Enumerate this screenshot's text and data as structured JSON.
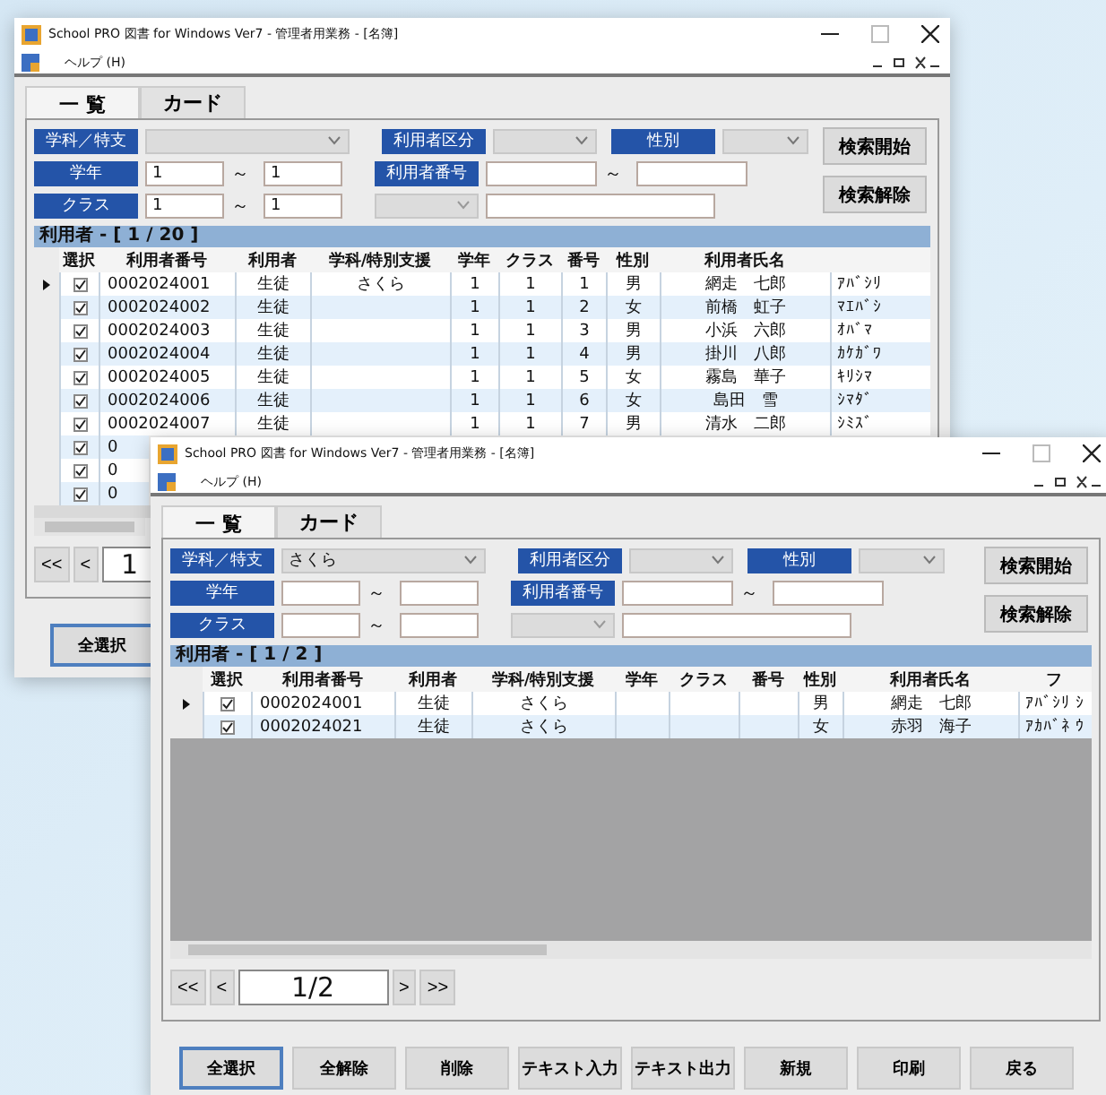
{
  "windows": [
    {
      "title": "School PRO 図書 for Windows Ver7 - 管理者用業務 - [名簿]",
      "menu": [
        "ヘルプ (H)"
      ],
      "tabs": [
        {
          "label": "一 覧",
          "selected": true
        },
        {
          "label": "カード",
          "selected": false
        }
      ],
      "filters": {
        "dept": {
          "label": "学科／特支"
        },
        "user_type": {
          "label": "利用者区分"
        },
        "gender": {
          "label": "性別"
        },
        "grade": {
          "label": "学年",
          "from": "1",
          "sep": "～",
          "to": "1"
        },
        "class": {
          "label": "クラス",
          "from": "1",
          "sep": "～",
          "to": "1"
        },
        "user_no": {
          "label": "利用者番号",
          "sep": "～"
        }
      },
      "search_buttons": [
        "検索開始",
        "検索解除"
      ],
      "table": {
        "caption": "利用者 - [ 1 / 20 ]",
        "check_column": "選択",
        "columns": [
          "利用者番号",
          "利用者",
          "学科/特別支援",
          "学年",
          "クラス",
          "番号",
          "性別",
          "利用者氏名"
        ],
        "rows": [
          {
            "current": true,
            "checked": true,
            "cells": [
              "0002024001",
              "生徒",
              "さくら",
              "1",
              "1",
              "1",
              "男",
              "網走　七郎",
              "ｱﾊﾞｼﾘ"
            ]
          },
          {
            "current": false,
            "checked": true,
            "cells": [
              "0002024002",
              "生徒",
              null,
              "1",
              "1",
              "2",
              "女",
              "前橋　虹子",
              "ﾏｴﾊﾞｼ"
            ]
          },
          {
            "current": false,
            "checked": true,
            "cells": [
              "0002024003",
              "生徒",
              null,
              "1",
              "1",
              "3",
              "男",
              "小浜　六郎",
              "ｵﾊﾞﾏ"
            ]
          },
          {
            "current": false,
            "checked": true,
            "cells": [
              "0002024004",
              "生徒",
              null,
              "1",
              "1",
              "4",
              "男",
              "掛川　八郎",
              "ｶｹｶﾞﾜ"
            ]
          },
          {
            "current": false,
            "checked": true,
            "cells": [
              "0002024005",
              "生徒",
              null,
              "1",
              "1",
              "5",
              "女",
              "霧島　華子",
              "ｷﾘｼﾏ"
            ]
          },
          {
            "current": false,
            "checked": true,
            "cells": [
              "0002024006",
              "生徒",
              null,
              "1",
              "1",
              "6",
              "女",
              "島田　雪",
              "ｼﾏﾀﾞ"
            ]
          },
          {
            "current": false,
            "checked": true,
            "cells": [
              "0002024007",
              "生徒",
              null,
              "1",
              "1",
              "7",
              "男",
              "清水　二郎",
              "ｼﾐｽﾞ"
            ]
          },
          {
            "current": false,
            "checked": true,
            "cells": [
              "0"
            ]
          },
          {
            "current": false,
            "checked": true,
            "cells": [
              "0"
            ]
          },
          {
            "current": false,
            "checked": true,
            "cells": [
              "0"
            ]
          }
        ]
      },
      "pager": {
        "first": "<<",
        "prev": "<",
        "page": "1"
      },
      "buttons": [
        {
          "label": "全選択",
          "focused": true
        }
      ]
    },
    {
      "title": "School PRO 図書 for Windows Ver7 - 管理者用業務 - [名簿]",
      "menu": [
        "ヘルプ (H)"
      ],
      "tabs": [
        {
          "label": "一 覧",
          "selected": true
        },
        {
          "label": "カード",
          "selected": false
        }
      ],
      "filters": {
        "dept": {
          "label": "学科／特支",
          "value": "さくら"
        },
        "user_type": {
          "label": "利用者区分"
        },
        "gender": {
          "label": "性別"
        },
        "grade": {
          "label": "学年",
          "sep": "～"
        },
        "class": {
          "label": "クラス",
          "sep": "～"
        },
        "user_no": {
          "label": "利用者番号",
          "sep": "～"
        }
      },
      "search_buttons": [
        "検索開始",
        "検索解除"
      ],
      "table": {
        "caption": "利用者 - [ 1 / 2 ]",
        "check_column": "選択",
        "columns": [
          "利用者番号",
          "利用者",
          "学科/特別支援",
          "学年",
          "クラス",
          "番号",
          "性別",
          "利用者氏名",
          "フ"
        ],
        "rows": [
          {
            "current": true,
            "checked": true,
            "cells": [
              "0002024001",
              "生徒",
              "さくら",
              null,
              null,
              null,
              "男",
              "網走　七郎",
              "ｱﾊﾞｼﾘ ｼ"
            ]
          },
          {
            "current": false,
            "checked": true,
            "cells": [
              "0002024021",
              "生徒",
              "さくら",
              null,
              null,
              null,
              "女",
              "赤羽　海子",
              "ｱｶﾊﾞﾈ ｳ"
            ]
          }
        ]
      },
      "pager": {
        "first": "<<",
        "prev": "<",
        "page": "1/2",
        "next": ">",
        "last": ">>"
      },
      "buttons": [
        {
          "label": "全選択",
          "focused": true
        },
        {
          "label": "全解除",
          "focused": false
        },
        {
          "label": "削除",
          "focused": false
        },
        {
          "label": "テキスト入力",
          "focused": false
        },
        {
          "label": "テキスト出力",
          "focused": false
        },
        {
          "label": "新規",
          "focused": false
        },
        {
          "label": "印刷",
          "focused": false
        },
        {
          "label": "戻る",
          "focused": false
        }
      ]
    }
  ]
}
